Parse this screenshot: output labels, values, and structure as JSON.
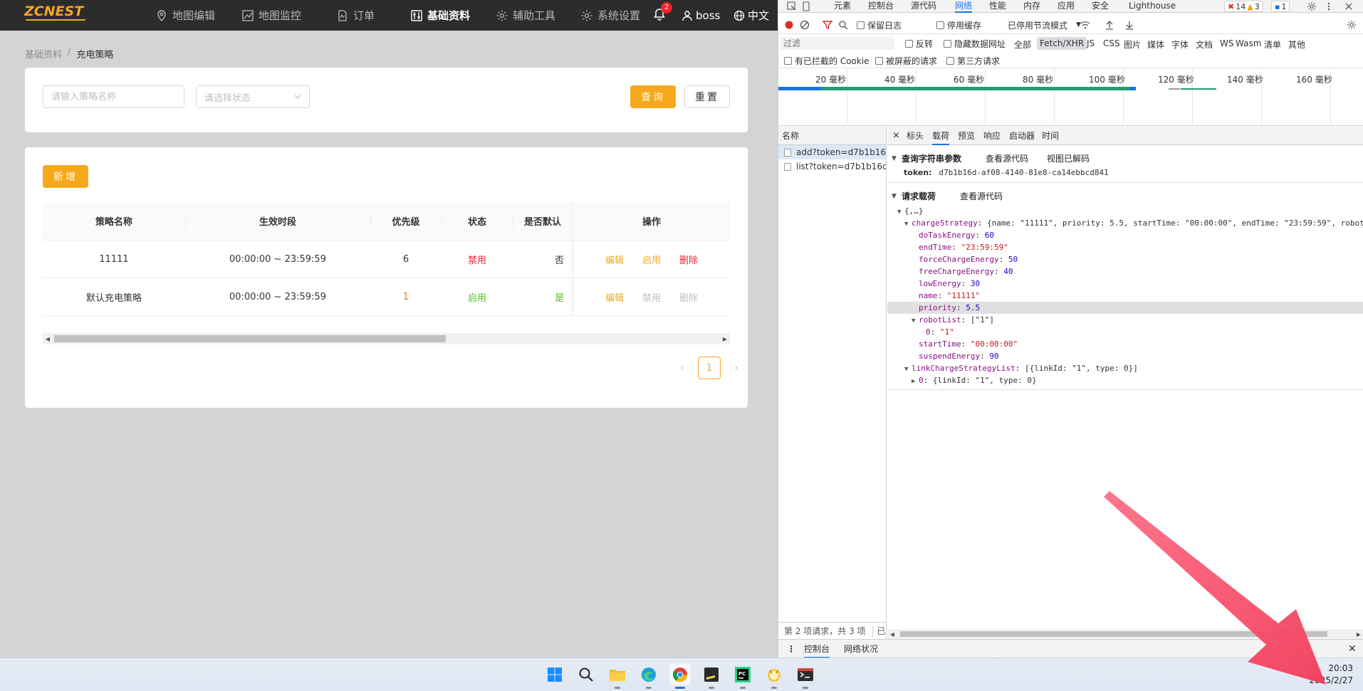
{
  "app": {
    "logo": "ZCNEST",
    "nav": [
      {
        "label": "地图编辑",
        "icon": "map-pin-icon"
      },
      {
        "label": "地图监控",
        "icon": "chart-line-icon"
      },
      {
        "label": "订单",
        "icon": "document-icon"
      },
      {
        "label": "基础资料",
        "icon": "sliders-icon"
      },
      {
        "label": "辅助工具",
        "icon": "gear-icon"
      },
      {
        "label": "系统设置",
        "icon": "gear-icon"
      }
    ],
    "notifications": {
      "count": "2",
      "icon": "bell-icon"
    },
    "user": "boss",
    "language": "中文",
    "breadcrumb": {
      "parent": "基础资料",
      "separator": "/",
      "current": "充电策略"
    },
    "search": {
      "name_placeholder": "请输入策略名称",
      "status_placeholder": "请选择状态",
      "query_label": "查询",
      "reset_label": "重置"
    },
    "add_label": "新增",
    "table": {
      "columns": [
        "策略名称",
        "生效时段",
        "优先级",
        "状态",
        "是否默认",
        "操作"
      ],
      "rows": [
        {
          "name": "11111",
          "period": "00:00:00 ~ 23:59:59",
          "priority": "6",
          "status": "禁用",
          "is_default": "否",
          "actions": {
            "edit": "编辑",
            "toggle": "启用",
            "delete": "删除"
          }
        },
        {
          "name": "默认充电策略",
          "period": "00:00:00 ~ 23:59:59",
          "priority": "1",
          "status": "启用",
          "is_default": "是",
          "actions": {
            "edit": "编辑",
            "toggle": "禁用",
            "delete": "删除"
          }
        }
      ]
    },
    "pagination": {
      "current": "1"
    },
    "colors": {
      "accent": "#f5a91a",
      "danger": "#f5222d",
      "success": "#52c41a"
    }
  },
  "devtools": {
    "tabs": [
      "元素",
      "控制台",
      "源代码",
      "网络",
      "性能",
      "内存",
      "应用",
      "安全",
      "Lighthouse"
    ],
    "active_tab": "网络",
    "errors": "14",
    "warnings": "3",
    "messages": "1",
    "toolbar": {
      "preserve_log": "保留日志",
      "disable_cache": "停用缓存",
      "throttle": "已停用节流模式"
    },
    "filter": {
      "placeholder": "过滤",
      "invert": "反转",
      "hide_data_urls": "隐藏数据网址",
      "types": [
        "全部",
        "Fetch/XHR",
        "JS",
        "CSS",
        "图片",
        "媒体",
        "字体",
        "文档",
        "WS",
        "Wasm",
        "清单",
        "其他"
      ],
      "active_type": "Fetch/XHR",
      "blocked_cookies": "有已拦截的 Cookie",
      "blocked_requests": "被屏蔽的请求",
      "third_party": "第三方请求"
    },
    "timeline_labels": [
      "20 毫秒",
      "40 毫秒",
      "60 毫秒",
      "80 毫秒",
      "100 毫秒",
      "120 毫秒",
      "140 毫秒",
      "160 毫秒"
    ],
    "requests": {
      "header": "名称",
      "items": [
        "add?token=d7b1b16...",
        "list?token=d7b1b16d..."
      ],
      "status": "第 2 项请求，共 3 项",
      "status_extra": "已"
    },
    "detail_tabs": [
      "标头",
      "载荷",
      "预览",
      "响应",
      "启动器",
      "时间"
    ],
    "active_detail_tab": "载荷",
    "query_params": {
      "title": "查询字符串参数",
      "view_source": "查看源代码",
      "view_decoded": "视图已解码",
      "token_key": "token:",
      "token_value": "d7b1b16d-af08-4140-81e8-ca14ebbcd841"
    },
    "payload": {
      "title": "请求载荷",
      "view_source": "查看源代码",
      "root": "{,…}",
      "charge_key": "chargeStrategy",
      "charge_preview": "{name: \"11111\", priority: 5.5, startTime: \"00:00:00\", endTime: \"23:59:59\", robot",
      "fields": [
        {
          "key": "doTaskEnergy",
          "value": "60",
          "kind": "n"
        },
        {
          "key": "endTime",
          "value": "\"23:59:59\"",
          "kind": "s"
        },
        {
          "key": "forceChargeEnergy",
          "value": "50",
          "kind": "n"
        },
        {
          "key": "freeChargeEnergy",
          "value": "40",
          "kind": "n"
        },
        {
          "key": "lowEnergy",
          "value": "30",
          "kind": "n"
        },
        {
          "key": "name",
          "value": "\"11111\"",
          "kind": "s"
        },
        {
          "key": "priority",
          "value": "5.5",
          "kind": "n"
        }
      ],
      "robot_key": "robotList",
      "robot_preview": "[\"1\"]",
      "robot_item_key": "0",
      "robot_item_value": "\"1\"",
      "fields2": [
        {
          "key": "startTime",
          "value": "\"00:00:00\"",
          "kind": "s"
        },
        {
          "key": "suspendEnergy",
          "value": "90",
          "kind": "n"
        }
      ],
      "link_key": "linkChargeStrategyList",
      "link_preview": "[{linkId: \"1\", type: 0}]",
      "link_item_key": "0",
      "link_item_value": "{linkId: \"1\", type: 0}"
    },
    "drawer": [
      "控制台",
      "网络状况"
    ]
  },
  "taskbar": {
    "apps": [
      "windows-start-icon",
      "search-icon",
      "file-explorer-icon",
      "edge-icon",
      "chrome-icon",
      "sticky-notes-icon",
      "pycharm-icon",
      "app-icon",
      "terminal-icon"
    ],
    "time": "20:03",
    "date": "2025/2/27"
  }
}
